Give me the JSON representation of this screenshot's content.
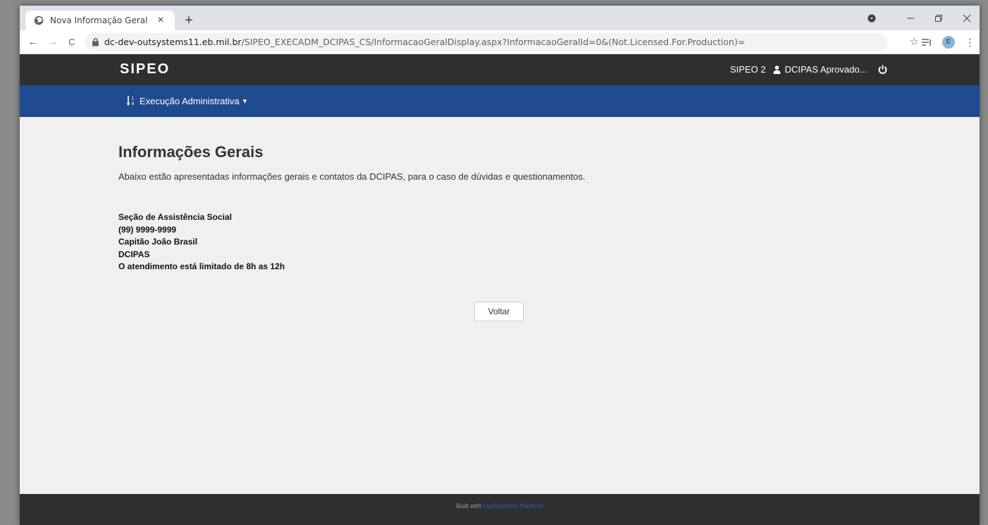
{
  "browser": {
    "tab_title": "Nova Informação Geral",
    "tab_close": "×",
    "new_tab": "+",
    "back": "←",
    "forward": "→",
    "reload": "C",
    "url_host": "dc-dev-outsystems11.eb.mil.br",
    "url_path": "/SIPEO_EXECADM_DCIPAS_CS/InformacaoGeralDisplay.aspx?InformacaoGeralId=0&(Not.Licensed.For.Production)=",
    "bookmark_star": "☆",
    "profile_initial": "E",
    "menu_kebab": "⋮"
  },
  "header": {
    "logo": "SIPEO",
    "system": "SIPEO 2",
    "user_name": "DCIPAS Aprovado..."
  },
  "menu": {
    "item_label": "Execução Administrativa",
    "caret": "▾"
  },
  "main": {
    "title": "Informações Gerais",
    "subtitle": "Abaixo estão apresentadas informações gerais e contatos da DCIPAS, para o caso de dúvidas e questionamentos.",
    "info_lines": [
      "Seção de Assistência Social",
      "(99) 9999-9999",
      "Capitão João Brasil",
      "DCIPAS",
      "O atendimento está limitado de 8h as 12h"
    ],
    "back_button": "Voltar"
  },
  "footer": {
    "built_with": "Built with",
    "platform": "OutSystems Platform"
  },
  "colors": {
    "topbar": "#2e2f30",
    "menubar": "#1e4b8f",
    "page_bg": "#f0f0f0"
  }
}
